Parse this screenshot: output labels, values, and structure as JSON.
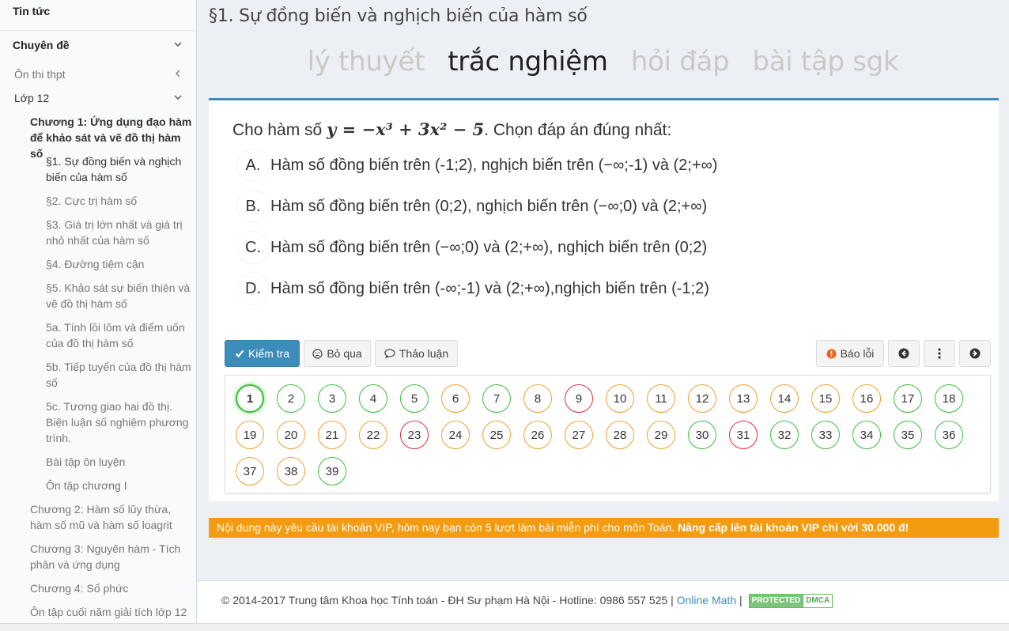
{
  "sidebar": {
    "news": "Tin tức",
    "topics": "Chuyên đề",
    "exam_prep": "Ôn thi thpt",
    "grade": "Lớp 12",
    "chapter1": "Chương 1: Ứng dụng đạo hàm để khảo sát và vẽ đồ thị hàm số",
    "lessons": [
      "§1. Sự đồng biến và nghịch biến của hàm số",
      "§2. Cực trị hàm số",
      "§3. Giá trị lớn nhất và giá trị nhỏ nhất của hàm số",
      "§4. Đường tiệm cận",
      "§5. Khảo sát sự biến thiên và vẽ đồ thị hàm số",
      "5a. Tính lồi lõm và điểm uốn của đồ thị hàm số",
      "5b. Tiếp tuyến của đồ thị hàm số",
      "5c. Tương giao hai đồ thị. Biện luận số nghiệm phương trình.",
      "Bài tập ôn luyện",
      "Ôn tập chương I"
    ],
    "chapters": [
      "Chương 2: Hàm số lũy thừa, hàm số mũ và hàm số loagrit",
      "Chương 3: Nguyên hàm - Tích phân và ứng dụng",
      "Chương 4: Số phức",
      "Ôn tập cuối năm giải tích lớp 12"
    ]
  },
  "page_title": "§1. Sự đồng biến và nghịch biến của hàm số",
  "tabs": [
    "lý thuyết",
    "trắc nghiệm",
    "hỏi đáp",
    "bài tập sgk"
  ],
  "question": {
    "prefix": "Cho hàm số ",
    "formula": "y = −x³ + 3x² − 5",
    "suffix": ". Chọn đáp án đúng nhất:"
  },
  "options": [
    {
      "letter": "A.",
      "text": "Hàm số đồng biến trên (-1;2), nghịch biến trên (−∞;-1) và (2;+∞)"
    },
    {
      "letter": "B.",
      "text": "Hàm số đồng biến trên (0;2), nghịch biến trên (−∞;0) và (2;+∞)"
    },
    {
      "letter": "C.",
      "text": "Hàm số đồng biến trên (−∞;0) và (2;+∞), nghịch biến trên (0;2)"
    },
    {
      "letter": "D.",
      "text": "Hàm số đồng biến trên (-∞;-1) và (2;+∞),nghịch biến trên (-1;2)"
    }
  ],
  "buttons": {
    "check": "Kiểm tra",
    "skip": "Bỏ qua",
    "discuss": "Thảo luận",
    "report": "Báo lỗi"
  },
  "question_numbers": [
    {
      "n": "1",
      "status": "current"
    },
    {
      "n": "2",
      "status": "green"
    },
    {
      "n": "3",
      "status": "green"
    },
    {
      "n": "4",
      "status": "green"
    },
    {
      "n": "5",
      "status": "green"
    },
    {
      "n": "6",
      "status": "orange"
    },
    {
      "n": "7",
      "status": "green"
    },
    {
      "n": "8",
      "status": "orange"
    },
    {
      "n": "9",
      "status": "red"
    },
    {
      "n": "10",
      "status": "orange"
    },
    {
      "n": "11",
      "status": "orange"
    },
    {
      "n": "12",
      "status": "orange"
    },
    {
      "n": "13",
      "status": "orange"
    },
    {
      "n": "14",
      "status": "orange"
    },
    {
      "n": "15",
      "status": "orange"
    },
    {
      "n": "16",
      "status": "orange"
    },
    {
      "n": "17",
      "status": "green"
    },
    {
      "n": "18",
      "status": "green"
    },
    {
      "n": "19",
      "status": "orange"
    },
    {
      "n": "20",
      "status": "orange"
    },
    {
      "n": "21",
      "status": "orange"
    },
    {
      "n": "22",
      "status": "orange"
    },
    {
      "n": "23",
      "status": "red"
    },
    {
      "n": "24",
      "status": "orange"
    },
    {
      "n": "25",
      "status": "orange"
    },
    {
      "n": "26",
      "status": "orange"
    },
    {
      "n": "27",
      "status": "orange"
    },
    {
      "n": "28",
      "status": "orange"
    },
    {
      "n": "29",
      "status": "orange"
    },
    {
      "n": "30",
      "status": "green"
    },
    {
      "n": "31",
      "status": "red"
    },
    {
      "n": "32",
      "status": "green"
    },
    {
      "n": "33",
      "status": "green"
    },
    {
      "n": "34",
      "status": "green"
    },
    {
      "n": "35",
      "status": "green"
    },
    {
      "n": "36",
      "status": "green"
    },
    {
      "n": "37",
      "status": "orange"
    },
    {
      "n": "38",
      "status": "orange"
    },
    {
      "n": "39",
      "status": "green"
    }
  ],
  "vip_notice": {
    "text": "Nội dung này yêu cầu tài khoản VIP, hôm nay bạn còn 5 lượt làm bài miễn phí cho môn Toán. ",
    "upgrade": "Nâng cấp lên tài khoản VIP chỉ với 30.000 đ!"
  },
  "footer": {
    "copyright": "© 2014-2017 Trung tâm Khoa học Tính toán - ĐH Sư phạm Hà Nội - Hotline: 0986 557 525 | ",
    "link": "Online Math",
    "sep": " | ",
    "dmca_left": "PROTECTED",
    "dmca_right": "DMCA"
  },
  "colors": {
    "primary": "#3c8dbc",
    "answered_correct": "#3cbf3c",
    "answered_partial": "#f0a030",
    "answered_wrong": "#e03040",
    "vip": "#f39c12"
  }
}
